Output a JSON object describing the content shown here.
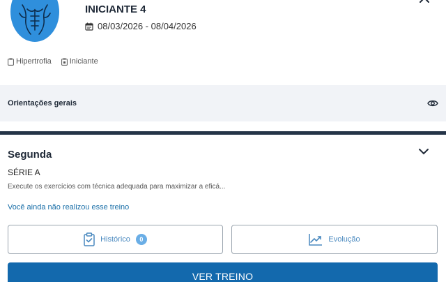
{
  "header": {
    "avatar_icon": "torso-muscle-icon",
    "title": "INICIANTE 4",
    "date_icon": "calendar-icon",
    "dates": "08/03/2026 - 08/04/2026",
    "collapse_icon": "chevron-up-icon"
  },
  "tags": [
    {
      "icon": "clipboard-icon",
      "label": "Hipertrofia"
    },
    {
      "icon": "clipboard-level-icon",
      "label": "Iniciante"
    }
  ],
  "orientations": {
    "label": "Orientações gerais",
    "icon": "eye-icon"
  },
  "workout": {
    "day": "Segunda",
    "expand_icon": "chevron-down-icon",
    "series": "SÉRIE A",
    "description": "Execute os exercícios com técnica adequada para maximizar a eficá...",
    "status": "Você ainda não realizou esse treino",
    "history_label": "Histórico",
    "history_count": "0",
    "evolution_label": "Evolução",
    "view_button": "VER TREINO"
  },
  "colors": {
    "accent": "#1369ad",
    "avatar": "#2f8fdc",
    "divider": "#243447",
    "link": "#1a6fa8"
  }
}
